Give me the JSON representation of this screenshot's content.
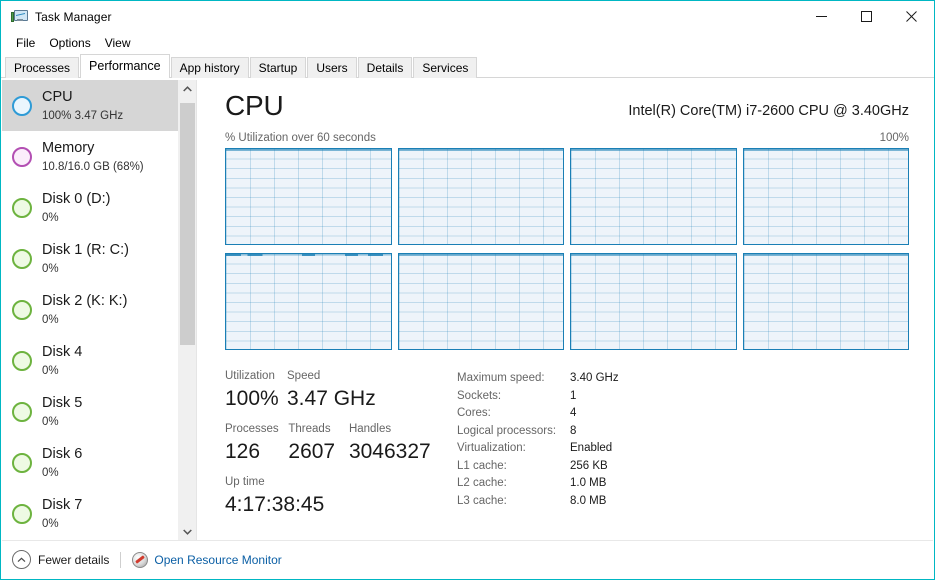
{
  "window": {
    "title": "Task Manager",
    "icon": "task-manager-icon",
    "controls": {
      "minimize": "minimize-icon",
      "maximize": "maximize-icon",
      "close": "close-icon"
    },
    "accent_color": "#00b7c3"
  },
  "menubar": {
    "items": [
      {
        "label": "File"
      },
      {
        "label": "Options"
      },
      {
        "label": "View"
      }
    ]
  },
  "tabs": {
    "active": "Performance",
    "items": [
      {
        "label": "Processes",
        "active": false
      },
      {
        "label": "Performance",
        "active": true
      },
      {
        "label": "App history",
        "active": false
      },
      {
        "label": "Startup",
        "active": false
      },
      {
        "label": "Users",
        "active": false
      },
      {
        "label": "Details",
        "active": false
      },
      {
        "label": "Services",
        "active": false
      }
    ]
  },
  "sidebar": {
    "scrollbar": {
      "up_arrow": "chevron-up-icon",
      "down_arrow": "chevron-down-icon",
      "thumb_top_pct": 5,
      "thumb_height_pct": 54
    },
    "items": [
      {
        "name": "CPU",
        "detail": "100%  3.47 GHz",
        "icon": "cpu-circle-icon",
        "color": "#2e9bd6",
        "selected": true
      },
      {
        "name": "Memory",
        "detail": "10.8/16.0 GB (68%)",
        "icon": "memory-circle-icon",
        "color": "#b34fb3",
        "selected": false
      },
      {
        "name": "Disk 0 (D:)",
        "detail": "0%",
        "icon": "disk-circle-icon",
        "color": "#6db33f",
        "selected": false
      },
      {
        "name": "Disk 1 (R: C:)",
        "detail": "0%",
        "icon": "disk-circle-icon",
        "color": "#6db33f",
        "selected": false
      },
      {
        "name": "Disk 2 (K: K:)",
        "detail": "0%",
        "icon": "disk-circle-icon",
        "color": "#6db33f",
        "selected": false
      },
      {
        "name": "Disk 4",
        "detail": "0%",
        "icon": "disk-circle-icon",
        "color": "#6db33f",
        "selected": false
      },
      {
        "name": "Disk 5",
        "detail": "0%",
        "icon": "disk-circle-icon",
        "color": "#6db33f",
        "selected": false
      },
      {
        "name": "Disk 6",
        "detail": "0%",
        "icon": "disk-circle-icon",
        "color": "#6db33f",
        "selected": false
      },
      {
        "name": "Disk 7",
        "detail": "0%",
        "icon": "disk-circle-icon",
        "color": "#6db33f",
        "selected": false
      }
    ]
  },
  "main": {
    "title": "CPU",
    "model": "Intel(R) Core(TM) i7-2600 CPU @ 3.40GHz",
    "graph_caption": "% Utilization over 60 seconds",
    "graph_max_label": "100%",
    "stats": {
      "utilization": {
        "label": "Utilization",
        "value": "100%"
      },
      "speed": {
        "label": "Speed",
        "value": "3.47 GHz"
      },
      "processes": {
        "label": "Processes",
        "value": "126"
      },
      "threads": {
        "label": "Threads",
        "value": "2607"
      },
      "handles": {
        "label": "Handles",
        "value": "3046327"
      },
      "uptime": {
        "label": "Up time",
        "value": "4:17:38:45"
      }
    },
    "specs": [
      {
        "key": "Maximum speed:",
        "value": "3.40 GHz"
      },
      {
        "key": "Sockets:",
        "value": "1"
      },
      {
        "key": "Cores:",
        "value": "4"
      },
      {
        "key": "Logical processors:",
        "value": "8"
      },
      {
        "key": "Virtualization:",
        "value": "Enabled"
      },
      {
        "key": "L1 cache:",
        "value": "256 KB"
      },
      {
        "key": "L2 cache:",
        "value": "1.0 MB"
      },
      {
        "key": "L3 cache:",
        "value": "8.0 MB"
      }
    ]
  },
  "chart_data": {
    "type": "line",
    "title": "% Utilization over 60 seconds",
    "xlabel": "60 seconds",
    "ylabel": "% Utilization",
    "ylim": [
      0,
      100
    ],
    "xlim": [
      0,
      60
    ],
    "grid": true,
    "legend": "none",
    "panel_layout": {
      "rows": 2,
      "cols": 4,
      "count": 8
    },
    "note": "One graph per logical processor; all pinned at 100% utilization (trace at top of each panel).",
    "series": [
      {
        "name": "CPU 0",
        "values": [
          100,
          100,
          100,
          100,
          100,
          100,
          100,
          100,
          100,
          100
        ],
        "spiky": false
      },
      {
        "name": "CPU 1",
        "values": [
          100,
          100,
          100,
          100,
          100,
          100,
          100,
          100,
          100,
          100
        ],
        "spiky": false
      },
      {
        "name": "CPU 2",
        "values": [
          100,
          100,
          100,
          100,
          100,
          100,
          100,
          100,
          100,
          100
        ],
        "spiky": false
      },
      {
        "name": "CPU 3",
        "values": [
          100,
          100,
          100,
          100,
          100,
          100,
          100,
          100,
          100,
          100
        ],
        "spiky": false
      },
      {
        "name": "CPU 4",
        "values": [
          100,
          99,
          100,
          97,
          100,
          98,
          100,
          99,
          100,
          100
        ],
        "spiky": true
      },
      {
        "name": "CPU 5",
        "values": [
          100,
          100,
          100,
          100,
          100,
          100,
          100,
          100,
          100,
          100
        ],
        "spiky": false
      },
      {
        "name": "CPU 6",
        "values": [
          100,
          100,
          100,
          100,
          100,
          100,
          100,
          100,
          100,
          100
        ],
        "spiky": false
      },
      {
        "name": "CPU 7",
        "values": [
          100,
          100,
          100,
          100,
          100,
          100,
          100,
          100,
          100,
          100
        ],
        "spiky": false
      }
    ]
  },
  "statusbar": {
    "fewer_details": {
      "label": "Fewer details",
      "icon": "chevron-up-circle-icon"
    },
    "resource_monitor": {
      "label": "Open Resource Monitor",
      "icon": "resource-monitor-icon",
      "color": "#0b5fa5"
    }
  }
}
